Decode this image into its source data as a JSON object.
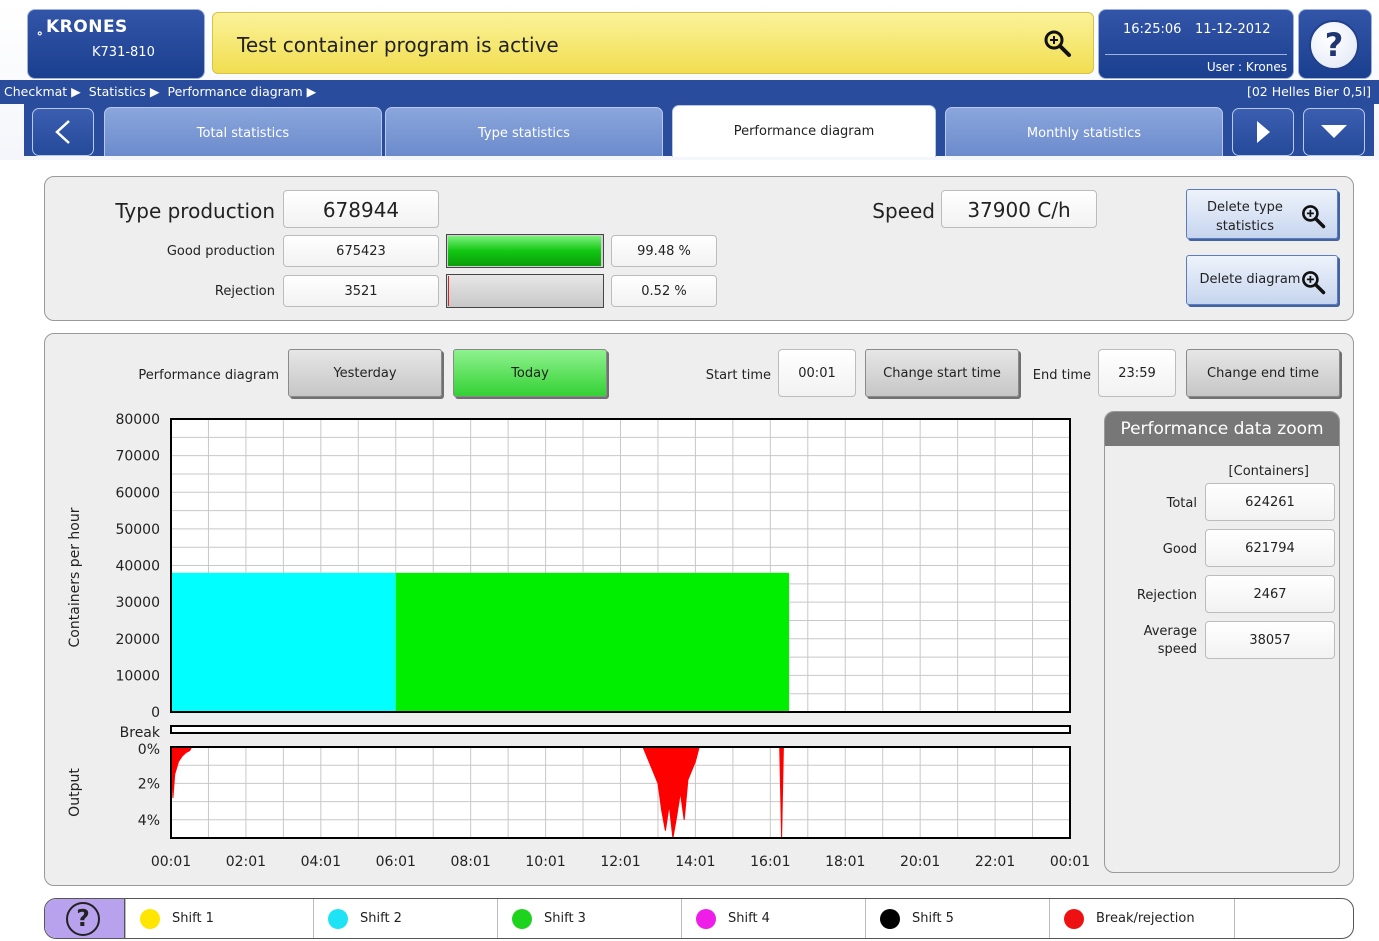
{
  "header": {
    "brand": "KRONES",
    "machine_id": "K731-810",
    "message": "Test container program is active",
    "time": "16:25:06",
    "date": "11-12-2012",
    "user": "User : Krones",
    "help_symbol": "?"
  },
  "breadcrumb": {
    "items": [
      "Checkmat ▶",
      "Statistics ▶",
      "Performance diagram ▶"
    ],
    "product": "[02 Helles Bier 0,5l]"
  },
  "tabs": [
    {
      "label": "Total statistics"
    },
    {
      "label": "Type statistics"
    },
    {
      "label": "Performance diagram",
      "active": true
    },
    {
      "label": "Monthly statistics"
    }
  ],
  "summary": {
    "type_production_label": "Type production",
    "type_production_value": "678944",
    "good_production_label": "Good production",
    "good_production_value": "675423",
    "good_production_percent": "99.48 %",
    "good_production_fraction": 0.9948,
    "rejection_label": "Rejection",
    "rejection_value": "3521",
    "rejection_percent": "0.52 %",
    "rejection_fraction": 0.0052,
    "speed_label": "Speed",
    "speed_value": "37900 C/h",
    "delete_type_statistics_label": "Delete type statistics",
    "delete_type_statistics_line1": "Delete type",
    "delete_type_statistics_line2": "statistics",
    "delete_diagram_label": "Delete diagram"
  },
  "diagram_controls": {
    "diagram_label": "Performance diagram",
    "yesterday_label": "Yesterday",
    "today_label": "Today",
    "start_time_label": "Start time",
    "start_time_value": "00:01",
    "change_start_label": "Change start time",
    "end_time_label": "End time",
    "end_time_value": "23:59",
    "change_end_label": "Change end time"
  },
  "zoom": {
    "title": "Performance data zoom",
    "unit": "[Containers]",
    "total_label": "Total",
    "total_value": "624261",
    "good_label": "Good",
    "good_value": "621794",
    "rejection_label": "Rejection",
    "rejection_value": "2467",
    "average_label_line1": "Average",
    "average_label_line2": "speed",
    "average_value": "38057"
  },
  "legend": [
    {
      "label": "Shift 1",
      "color": "#ffe600"
    },
    {
      "label": "Shift 2",
      "color": "#1ee3f5"
    },
    {
      "label": "Shift 3",
      "color": "#1ed31e"
    },
    {
      "label": "Shift 4",
      "color": "#ee1ee8"
    },
    {
      "label": "Shift 5",
      "color": "#000000"
    },
    {
      "label": "Break/rejection",
      "color": "#ee1111"
    }
  ],
  "chart_data": [
    {
      "type": "area",
      "ylabel": "Containers per hour",
      "ylim": [
        0,
        80000
      ],
      "yticks": [
        "80000",
        "70000",
        "60000",
        "50000",
        "40000",
        "30000",
        "20000",
        "10000",
        "0"
      ],
      "xticks": [
        "00:01",
        "02:01",
        "04:01",
        "06:01",
        "08:01",
        "10:01",
        "12:01",
        "14:01",
        "16:01",
        "18:01",
        "20:01",
        "22:01",
        "00:01"
      ],
      "x_hours_range": [
        0,
        24
      ],
      "grid": true,
      "series": [
        {
          "name": "Shift 2",
          "color": "#00ffff",
          "x_start": "00:01",
          "x_end": "06:01",
          "start_hour": 0,
          "end_hour": 6,
          "value": 38000
        },
        {
          "name": "Shift 3",
          "color": "#00ee00",
          "x_start": "06:01",
          "x_end": "16:31",
          "start_hour": 6,
          "end_hour": 16.5,
          "value": 38000
        }
      ]
    },
    {
      "type": "area",
      "ylabel": "Output",
      "break_label": "Break",
      "yticks": [
        "0%",
        "2%",
        "4%"
      ],
      "ylim": [
        0,
        5
      ],
      "xticks": [
        "00:01",
        "02:01",
        "04:01",
        "06:01",
        "08:01",
        "10:01",
        "12:01",
        "14:01",
        "16:01",
        "18:01",
        "20:01",
        "22:01",
        "00:01"
      ],
      "series": [
        {
          "name": "Break/rejection",
          "color": "#ff0000",
          "x": [
            0.0,
            0.05,
            0.1,
            0.2,
            0.3,
            0.4,
            0.5,
            0.55,
            12.6,
            12.8,
            13.0,
            13.1,
            13.2,
            13.3,
            13.4,
            13.5,
            13.6,
            13.7,
            13.8,
            14.0,
            14.1,
            16.25,
            16.3,
            16.35
          ],
          "y": [
            0,
            2.8,
            1.5,
            0.8,
            0.5,
            0.3,
            0.2,
            0,
            0,
            1.0,
            2.0,
            3.5,
            4.6,
            3.2,
            5.0,
            3.8,
            2.5,
            4.0,
            1.8,
            0.8,
            0,
            0,
            5.0,
            0
          ]
        }
      ]
    }
  ]
}
